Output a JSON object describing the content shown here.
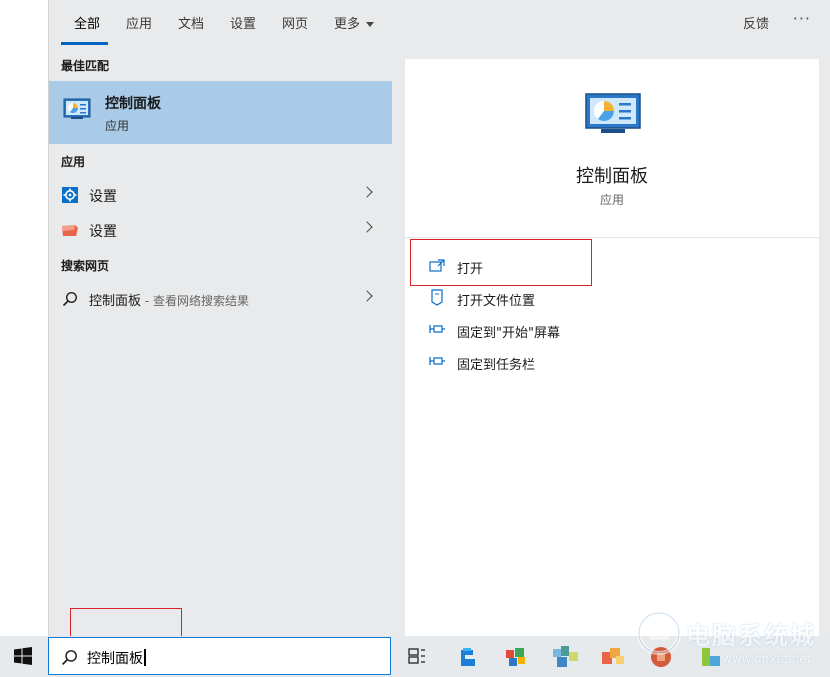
{
  "tabs": {
    "items": [
      "全部",
      "应用",
      "文档",
      "设置",
      "网页",
      "更多"
    ],
    "active": "全部",
    "feedback": "反馈",
    "more_dots": "···"
  },
  "left": {
    "best_match_title": "最佳匹配",
    "best_match": {
      "name": "控制面板",
      "type": "应用"
    },
    "apps_title": "应用",
    "apps": [
      {
        "label": "设置",
        "icon": "settings-gear-icon"
      },
      {
        "label": "设置",
        "icon": "settings-orange-icon"
      }
    ],
    "web_title": "搜索网页",
    "web": {
      "query": "控制面板",
      "hint": " - 查看网络搜索结果"
    }
  },
  "detail": {
    "name": "控制面板",
    "type": "应用",
    "actions": [
      {
        "label": "打开",
        "icon": "open-icon"
      },
      {
        "label": "打开文件位置",
        "icon": "file-location-icon"
      },
      {
        "label": "固定到\"开始\"屏幕",
        "icon": "pin-icon"
      },
      {
        "label": "固定到任务栏",
        "icon": "pin-icon"
      }
    ]
  },
  "taskbar": {
    "search_text": "控制面板",
    "icons": [
      "windows-start-icon",
      "task-view-icon",
      "edge-icon",
      "store-icon",
      "app-icon",
      "office-icon",
      "app-icon",
      "app-icon"
    ]
  },
  "watermark": {
    "line1": "电脑系统城",
    "line2": "www.dnxtc.net"
  },
  "colors": {
    "accent": "#0067c0",
    "highlight": "#a9cbe8",
    "annotation": "#d9232a"
  }
}
